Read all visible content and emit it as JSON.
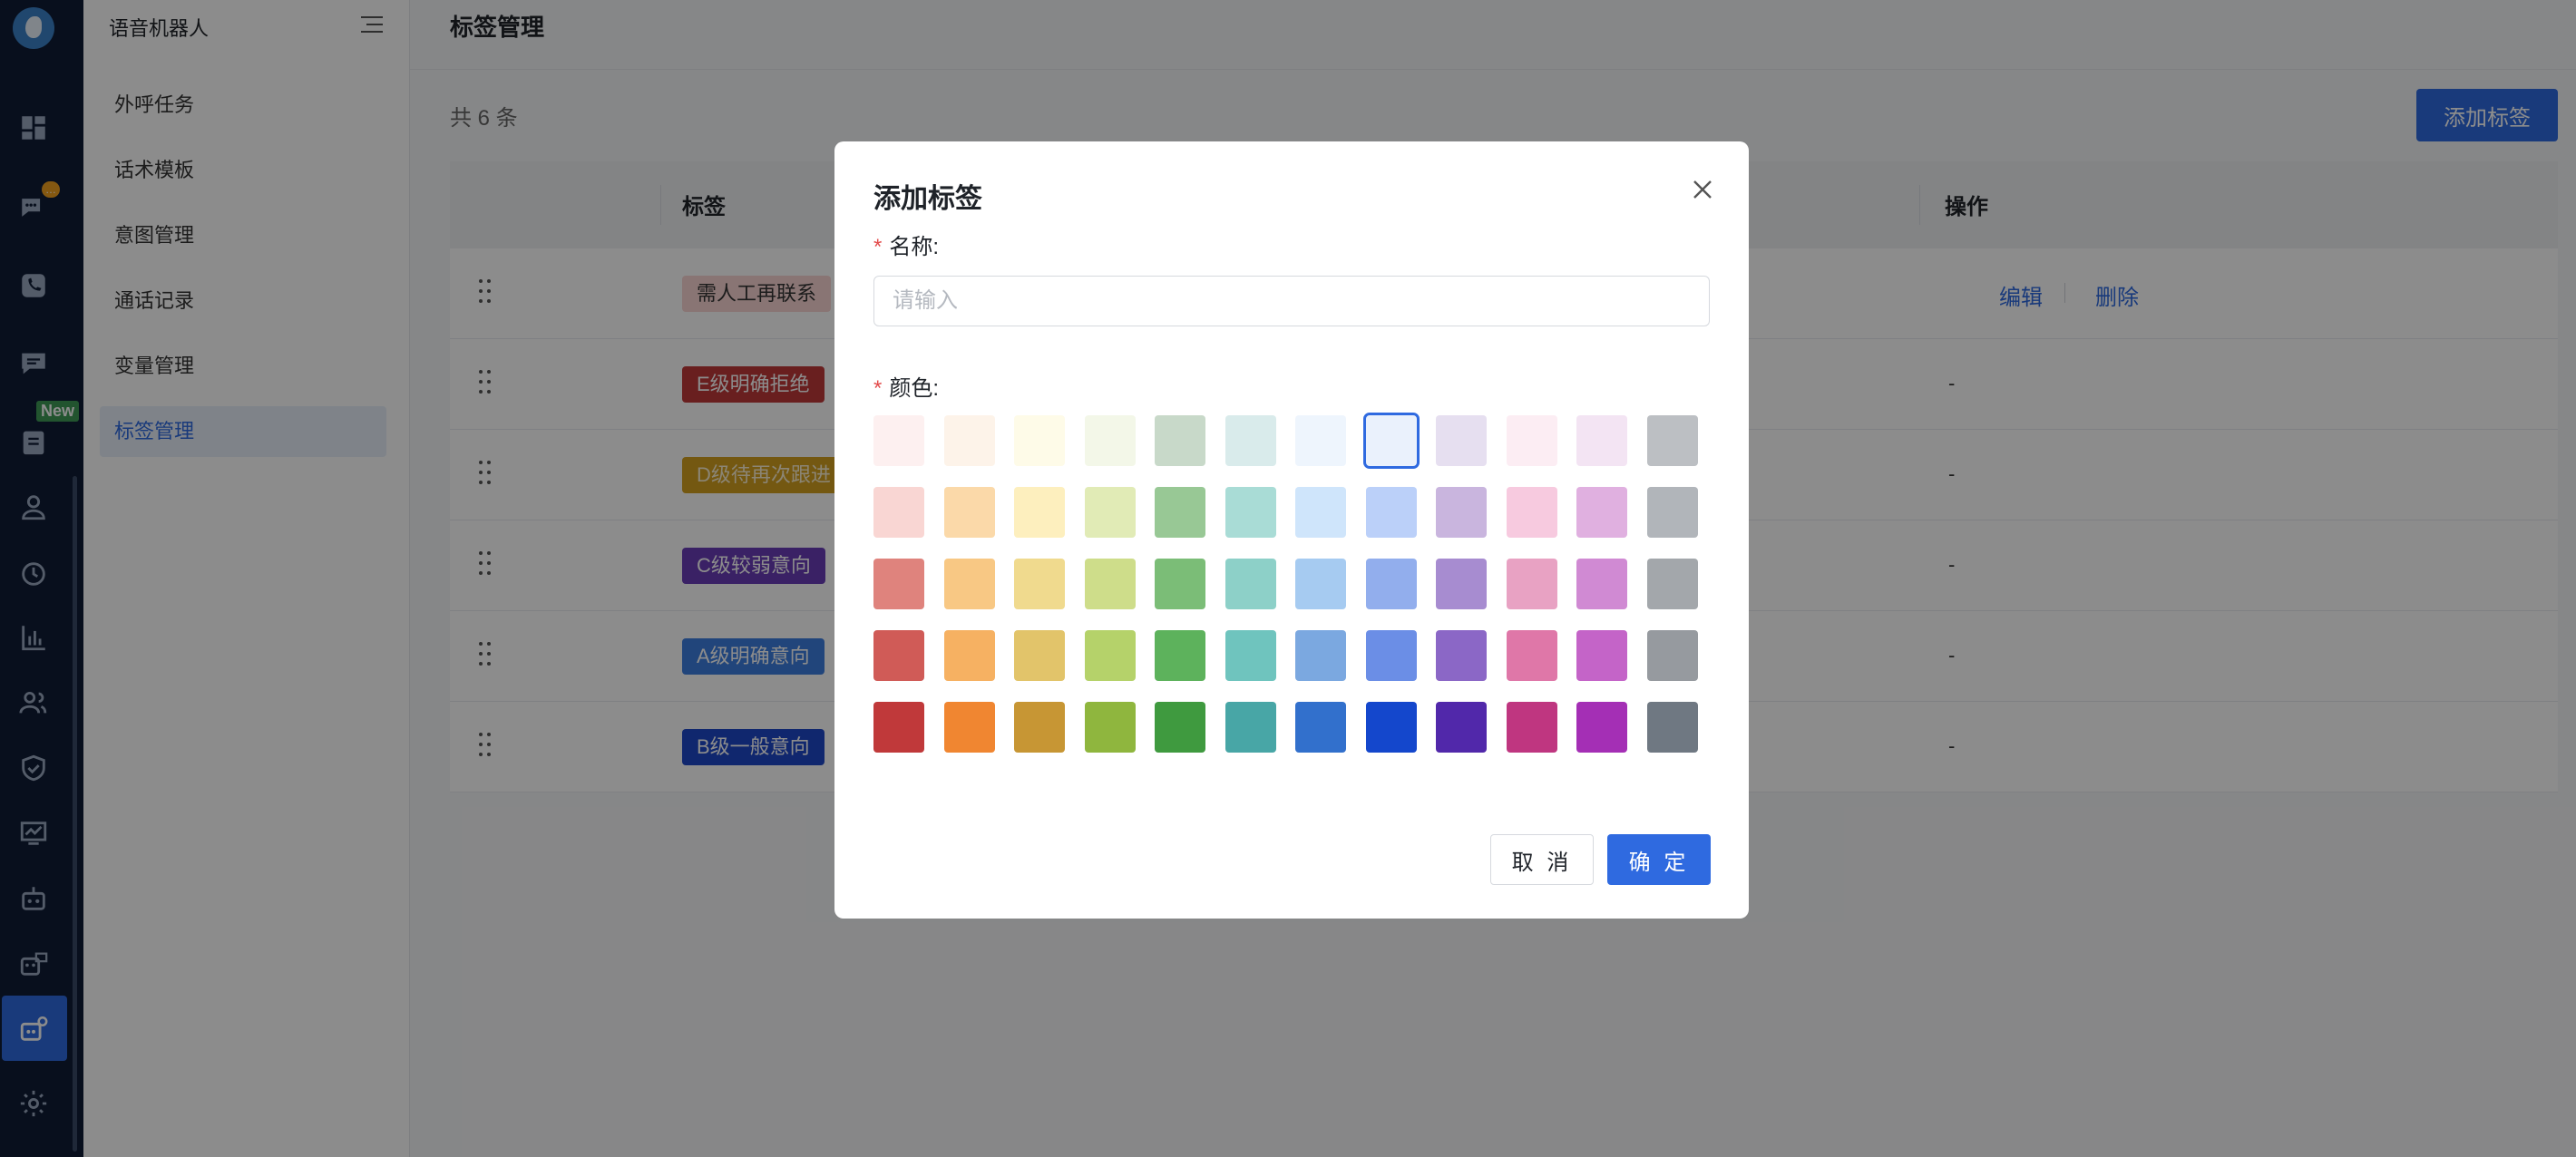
{
  "app": {
    "title": "语音机器人",
    "new_badge": "New",
    "rail_icons": [
      "dashboard-icon",
      "chat-icon",
      "phone-icon",
      "message-icon",
      "clipboard-icon",
      "user-icon",
      "history-icon",
      "bar-chart-icon",
      "users-icon",
      "shield-icon",
      "monitor-chart-icon",
      "robot-icon",
      "robot-mail-icon",
      "robot-settings-icon",
      "gear-icon"
    ]
  },
  "sidebar": {
    "items": [
      {
        "label": "外呼任务",
        "active": false
      },
      {
        "label": "话术模板",
        "active": false
      },
      {
        "label": "意图管理",
        "active": false
      },
      {
        "label": "通话记录",
        "active": false
      },
      {
        "label": "变量管理",
        "active": false
      },
      {
        "label": "标签管理",
        "active": true
      }
    ]
  },
  "main": {
    "page_title": "标签管理",
    "count": "共 6 条",
    "add_button": "添加标签",
    "columns": {
      "tag": "标签",
      "action": "操作"
    },
    "rows": [
      {
        "tag": "需人工再联系",
        "bg": "#f9d6d3",
        "fg": "#333333",
        "edit": "编辑",
        "delete": "删除"
      },
      {
        "tag": "E级明确拒绝",
        "bg": "#c0393a",
        "fg": "#ffffff",
        "dash": "-"
      },
      {
        "tag": "D级待再次跟进",
        "bg": "#d4a020",
        "fg": "#fdf3d6",
        "dash": "-"
      },
      {
        "tag": "C级较弱意向",
        "bg": "#6a3cb8",
        "fg": "#ffffff",
        "dash": "-"
      },
      {
        "tag": "A级明确意向",
        "bg": "#3d7ee0",
        "fg": "#ffffff",
        "dash": "-"
      },
      {
        "tag": "B级一般意向",
        "bg": "#1e48c8",
        "fg": "#ffffff",
        "dash": "-"
      }
    ]
  },
  "modal": {
    "title": "添加标签",
    "name_label": "名称:",
    "name_placeholder": "请输入",
    "name_value": "",
    "color_label": "颜色:",
    "required_mark": "*",
    "selected_color": "#eaf1fc",
    "colors": [
      [
        "#fdf0f0",
        "#fdf3e9",
        "#fefbe8",
        "#f3f7e8",
        "#c8d9c9",
        "#d9ebeb",
        "#eef5fd",
        "#eaf1fc",
        "#e6dff0",
        "#fcedf3",
        "#f3e4f3",
        "#bcbfc3"
      ],
      [
        "#f9d6d3",
        "#fbd9a9",
        "#fdefbe",
        "#e1ebb6",
        "#98c895",
        "#a9dcd6",
        "#cfe5fb",
        "#bbd0f9",
        "#c9b5de",
        "#f7cadf",
        "#e0b0e0",
        "#b1b5ba"
      ],
      [
        "#df837d",
        "#f8c884",
        "#f0da8e",
        "#cedd8a",
        "#7bbd77",
        "#8dd0c8",
        "#a6cbf1",
        "#92aeed",
        "#a78cd0",
        "#e8a2c3",
        "#d08ad3",
        "#a3a7ab"
      ],
      [
        "#d05b57",
        "#f6b162",
        "#e2c46a",
        "#b5d26a",
        "#5db25c",
        "#6fc4be",
        "#7ba8e0",
        "#6b8ee6",
        "#8b67c6",
        "#df77a8",
        "#c464c8",
        "#969a9f"
      ],
      [
        "#c0393a",
        "#f08631",
        "#c79634",
        "#8fb63e",
        "#3f9a3f",
        "#48a6a6",
        "#3270cc",
        "#1447cc",
        "#5128aa",
        "#bf3680",
        "#a42fb5",
        "#6f7882"
      ]
    ],
    "cancel": "取 消",
    "confirm": "确 定"
  }
}
